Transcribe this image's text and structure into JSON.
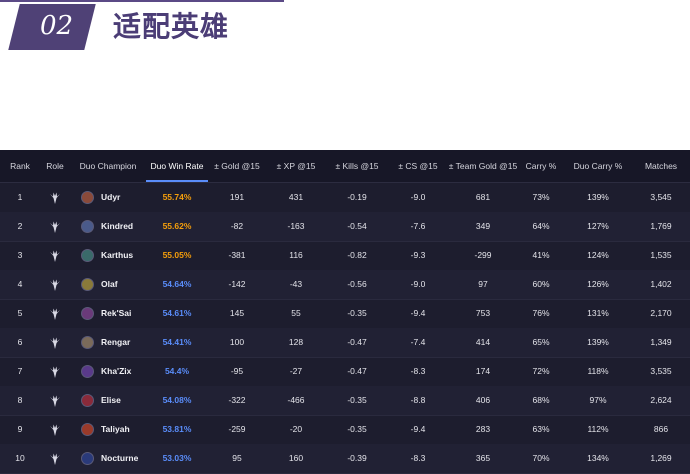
{
  "header": {
    "number": "02",
    "title": "适配英雄"
  },
  "colors": {
    "accent_purple": "#4f4176",
    "win_rate_orange": "#f59e0b",
    "win_rate_blue": "#5a8dfa",
    "table_bg": "#1d1d2e"
  },
  "table": {
    "columns": [
      "Rank",
      "Role",
      "Duo Champion",
      "Duo Win Rate",
      "± Gold @15",
      "± XP @15",
      "± Kills @15",
      "± CS @15",
      "± Team Gold @15",
      "Carry %",
      "Duo Carry %",
      "Matches"
    ],
    "active_column": "Duo Win Rate",
    "role_icon": "jungle-icon",
    "rows": [
      {
        "rank": "1",
        "champion": "Udyr",
        "win_rate": "55.74%",
        "win_rate_tier": "orange",
        "gold": "191",
        "xp": "431",
        "kills": "-0.19",
        "cs": "-9.0",
        "team_gold": "681",
        "carry": "73%",
        "duo_carry": "139%",
        "matches": "3,545",
        "icon_color": "#8a4a3a"
      },
      {
        "rank": "2",
        "champion": "Kindred",
        "win_rate": "55.62%",
        "win_rate_tier": "orange",
        "gold": "-82",
        "xp": "-163",
        "kills": "-0.54",
        "cs": "-7.6",
        "team_gold": "349",
        "carry": "64%",
        "duo_carry": "127%",
        "matches": "1,769",
        "icon_color": "#4a5a8a"
      },
      {
        "rank": "3",
        "champion": "Karthus",
        "win_rate": "55.05%",
        "win_rate_tier": "orange",
        "gold": "-381",
        "xp": "116",
        "kills": "-0.82",
        "cs": "-9.3",
        "team_gold": "-299",
        "carry": "41%",
        "duo_carry": "124%",
        "matches": "1,535",
        "icon_color": "#3a6a6a"
      },
      {
        "rank": "4",
        "champion": "Olaf",
        "win_rate": "54.64%",
        "win_rate_tier": "blue",
        "gold": "-142",
        "xp": "-43",
        "kills": "-0.56",
        "cs": "-9.0",
        "team_gold": "97",
        "carry": "60%",
        "duo_carry": "126%",
        "matches": "1,402",
        "icon_color": "#8a7a3a"
      },
      {
        "rank": "5",
        "champion": "Rek'Sai",
        "win_rate": "54.61%",
        "win_rate_tier": "blue",
        "gold": "145",
        "xp": "55",
        "kills": "-0.35",
        "cs": "-9.4",
        "team_gold": "753",
        "carry": "76%",
        "duo_carry": "131%",
        "matches": "2,170",
        "icon_color": "#6a3a7a"
      },
      {
        "rank": "6",
        "champion": "Rengar",
        "win_rate": "54.41%",
        "win_rate_tier": "blue",
        "gold": "100",
        "xp": "128",
        "kills": "-0.47",
        "cs": "-7.4",
        "team_gold": "414",
        "carry": "65%",
        "duo_carry": "139%",
        "matches": "1,349",
        "icon_color": "#7a6a5a"
      },
      {
        "rank": "7",
        "champion": "Kha'Zix",
        "win_rate": "54.4%",
        "win_rate_tier": "blue",
        "gold": "-95",
        "xp": "-27",
        "kills": "-0.47",
        "cs": "-8.3",
        "team_gold": "174",
        "carry": "72%",
        "duo_carry": "118%",
        "matches": "3,535",
        "icon_color": "#5a3a8a"
      },
      {
        "rank": "8",
        "champion": "Elise",
        "win_rate": "54.08%",
        "win_rate_tier": "blue",
        "gold": "-322",
        "xp": "-466",
        "kills": "-0.35",
        "cs": "-8.8",
        "team_gold": "406",
        "carry": "68%",
        "duo_carry": "97%",
        "matches": "2,624",
        "icon_color": "#8a2a3a"
      },
      {
        "rank": "9",
        "champion": "Taliyah",
        "win_rate": "53.81%",
        "win_rate_tier": "blue",
        "gold": "-259",
        "xp": "-20",
        "kills": "-0.35",
        "cs": "-9.4",
        "team_gold": "283",
        "carry": "63%",
        "duo_carry": "112%",
        "matches": "866",
        "icon_color": "#9a3a2a"
      },
      {
        "rank": "10",
        "champion": "Nocturne",
        "win_rate": "53.03%",
        "win_rate_tier": "blue",
        "gold": "95",
        "xp": "160",
        "kills": "-0.39",
        "cs": "-8.3",
        "team_gold": "365",
        "carry": "70%",
        "duo_carry": "134%",
        "matches": "1,269",
        "icon_color": "#2a3a7a"
      }
    ]
  }
}
